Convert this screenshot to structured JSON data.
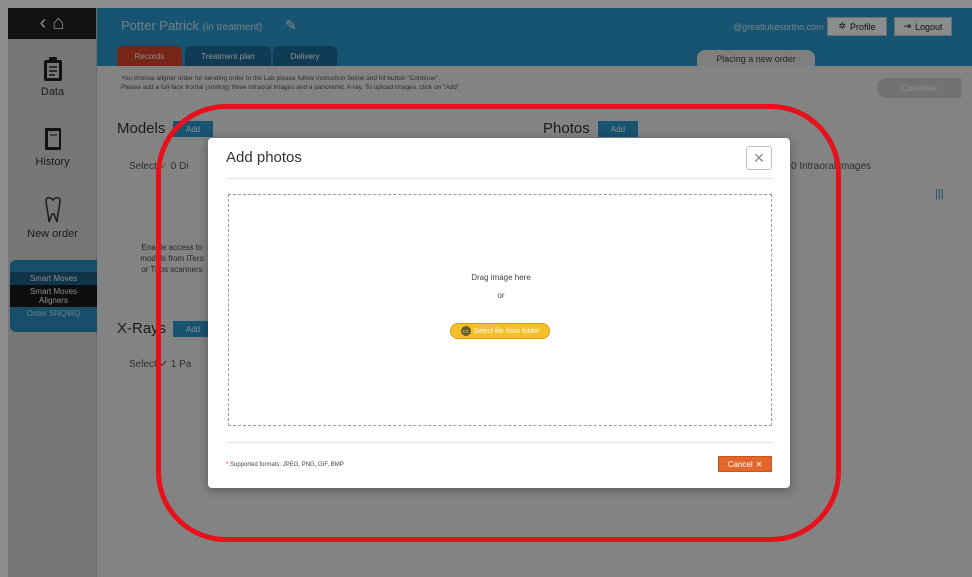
{
  "sidebar": {
    "top_icons": "< 🏠",
    "items": [
      {
        "label": "Data",
        "icon": "clipboard-icon"
      },
      {
        "label": "History",
        "icon": "book-icon"
      },
      {
        "label": "New order",
        "icon": "tooth-icon"
      }
    ],
    "order": {
      "line1": "Smart Moves",
      "line2a": "Smart Moves",
      "line2b": "Aligners",
      "line3": "Order SNQWQ"
    }
  },
  "header": {
    "patient_name": "Potter Patrick",
    "patient_status": "(in treatment)",
    "email": "@greatlukesortho.com",
    "profile_label": "Profile",
    "logout_label": "Logout",
    "tabs": [
      "Records",
      "Treatment plan",
      "Delivery"
    ],
    "placing_label": "Placing a new order"
  },
  "page": {
    "instruction_line1": "You choose aligner order for sending order to the Lab please follow instruction below and hit button \"Continue\".",
    "instruction_line2": "Please add a full-face frontal (smiling) three intraoral images and a panoramic X-ray. To upload images, click on \"Add\"",
    "continue_label": "Continue",
    "models_title": "Models",
    "photos_title": "Photos",
    "xrays_title": "X-Rays",
    "add_label": "Add",
    "select_models": "Select",
    "models_count": "0 Di",
    "select_xray": "Select",
    "xray_count": "1 Pa",
    "intraoral_text": "0 Intraoral images",
    "enable_line1": "Enable access to",
    "enable_line2": "models from iTero",
    "enable_line3": "or Trios scanners"
  },
  "modal": {
    "title": "Add photos",
    "close_symbol": "×",
    "drag_text": "Drag image here",
    "or_text": "or",
    "select_label": "Select file from folder",
    "formats_text": "Supported formats: JPEG, PNG, GIF, BMP",
    "cancel_label": "Cancel"
  },
  "colors": {
    "header_blue": "#2a9ad0",
    "records_tab": "#d9442b",
    "select_button": "#f5bf28",
    "cancel_button": "#e3672a",
    "annotation_red": "#e8101a"
  }
}
